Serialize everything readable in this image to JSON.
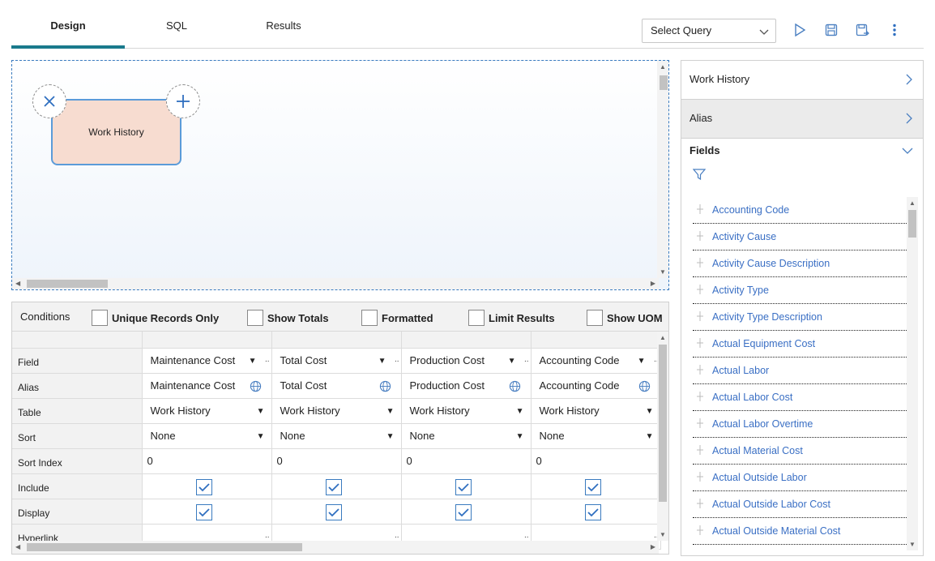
{
  "tabs": [
    {
      "label": "Design",
      "active": true
    },
    {
      "label": "SQL",
      "active": false
    },
    {
      "label": "Results",
      "active": false
    }
  ],
  "toolbar": {
    "select_query": "Select Query",
    "icons": [
      "play-icon",
      "save-icon",
      "save-as-icon",
      "more-vertical-icon"
    ]
  },
  "canvas": {
    "node_label": "Work History"
  },
  "conditions": {
    "label": "Conditions",
    "options": [
      {
        "label": "Unique Records Only",
        "checked": false
      },
      {
        "label": "Show Totals",
        "checked": false
      },
      {
        "label": "Formatted",
        "checked": false
      },
      {
        "label": "Limit Results",
        "checked": false
      },
      {
        "label": "Show UOM",
        "checked": false
      }
    ]
  },
  "grid": {
    "row_labels": [
      "Field",
      "Alias",
      "Table",
      "Sort",
      "Sort Index",
      "Include",
      "Display",
      "Hyperlink"
    ],
    "columns": [
      {
        "field": "Maintenance Cost",
        "alias": "Maintenance Cost",
        "table": "Work History",
        "sort": "None",
        "sort_index": "0",
        "include": true,
        "display": true
      },
      {
        "field": "Total Cost",
        "alias": "Total Cost",
        "table": "Work History",
        "sort": "None",
        "sort_index": "0",
        "include": true,
        "display": true
      },
      {
        "field": "Production Cost",
        "alias": "Production Cost",
        "table": "Work History",
        "sort": "None",
        "sort_index": "0",
        "include": true,
        "display": true
      },
      {
        "field": "Accounting Code",
        "alias": "Accounting Code",
        "table": "Work History",
        "sort": "None",
        "sort_index": "0",
        "include": true,
        "display": true
      }
    ]
  },
  "right_panel": {
    "source": "Work History",
    "alias": "Alias",
    "fields_title": "Fields",
    "fields": [
      "Accounting Code",
      "Activity Cause",
      "Activity Cause Description",
      "Activity Type",
      "Activity Type Description",
      "Actual Equipment Cost",
      "Actual Labor",
      "Actual Labor Cost",
      "Actual Labor Overtime",
      "Actual Material Cost",
      "Actual Outside Labor",
      "Actual Outside Labor Cost",
      "Actual Outside Material Cost"
    ]
  },
  "colors": {
    "accent": "#1a7a8c",
    "link": "#3a6fc4",
    "node_fill": "#f7dcd0",
    "node_border": "#5b9bd9"
  }
}
